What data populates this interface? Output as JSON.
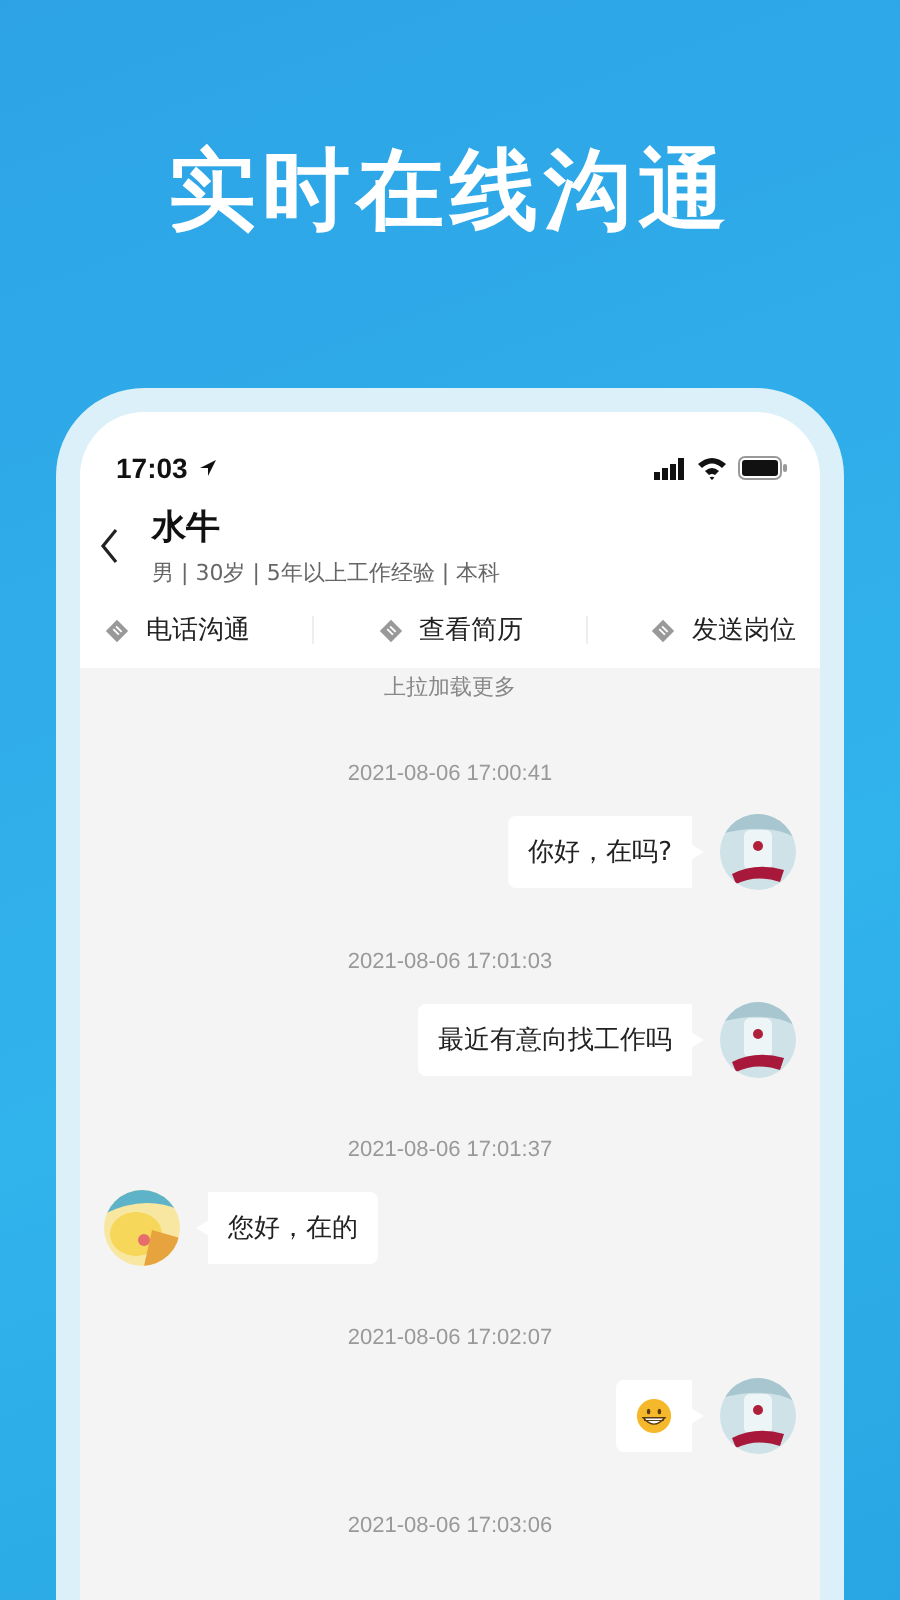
{
  "headline": "实时在线沟通",
  "status_bar": {
    "time": "17:03"
  },
  "contact": {
    "name": "水牛",
    "details": "男 | 30岁 | 5年以上工作经验 | 本科"
  },
  "actions": [
    {
      "label": "电话沟通"
    },
    {
      "label": "查看简历"
    },
    {
      "label": "发送岗位"
    }
  ],
  "load_more": "上拉加载更多",
  "messages": [
    {
      "time": "2021-08-06 17:00:41",
      "outgoing": true,
      "kind": "text",
      "text": "你好，在吗?"
    },
    {
      "time": "2021-08-06 17:01:03",
      "outgoing": true,
      "kind": "text",
      "text": "最近有意向找工作吗"
    },
    {
      "time": "2021-08-06 17:01:37",
      "outgoing": false,
      "kind": "text",
      "text": "您好，在的"
    },
    {
      "time": "2021-08-06 17:02:07",
      "outgoing": true,
      "kind": "emoji"
    }
  ],
  "trailing_time": "2021-08-06 17:03:06"
}
